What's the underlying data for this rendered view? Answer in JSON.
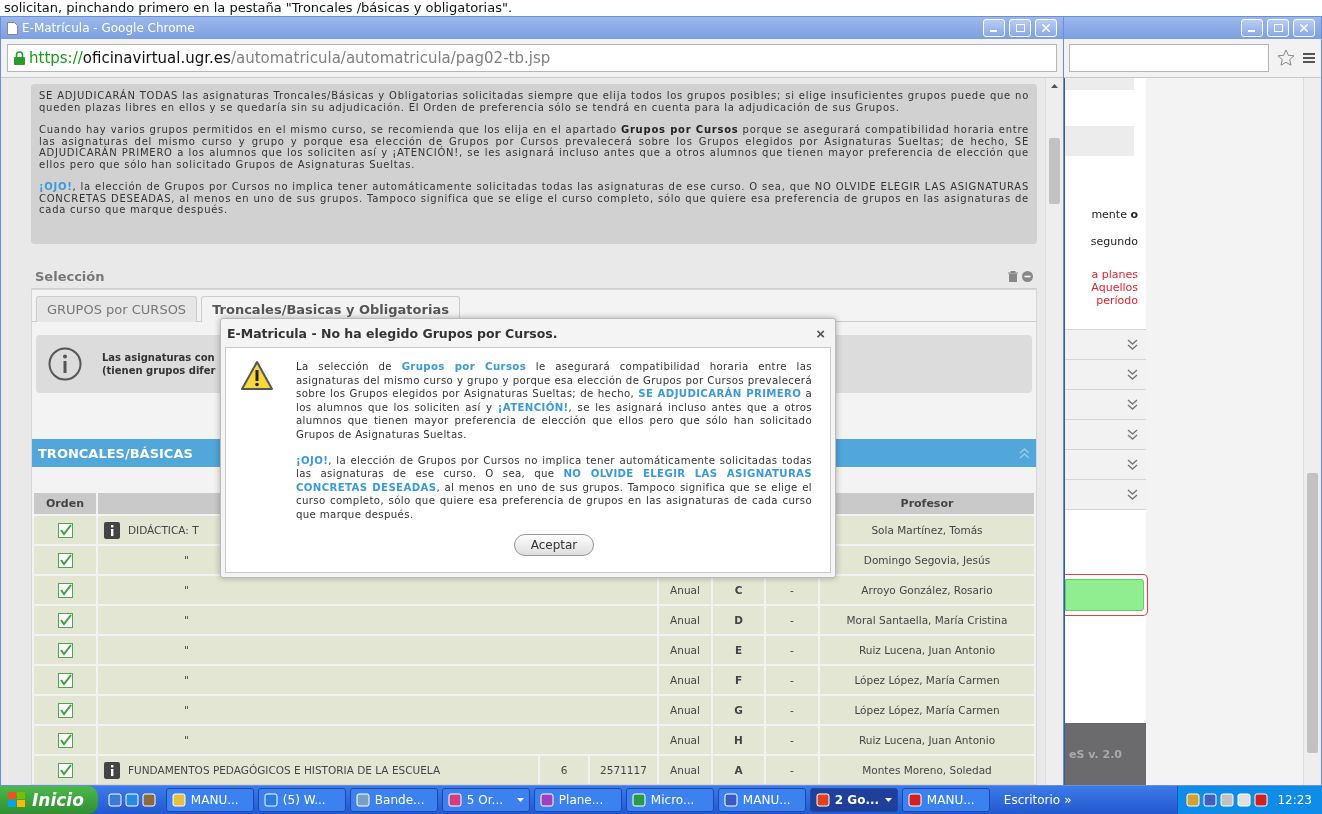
{
  "caption": "solicitan, pinchando primero en la pestaña \"Troncales /básicas y obligatorias\".",
  "window": {
    "title": "E-Matrícula - Google Chrome",
    "url": {
      "scheme": "https://",
      "host": "oficinavirtual.ugr.es",
      "path": "/automatricula/automatricula/pag02-tb.jsp"
    }
  },
  "info_box": [
    "SE ADJUDICARÁN TODAS las asignaturas Troncales/Básicas y Obligatorias solicitadas siempre que elija todos los grupos posibles; si elige insuficientes grupos puede que no queden plazas libres en ellos y se quedaría sin su adjudicación. El Orden de preferencia sólo se tendrá en cuenta para la adjudicación de sus Grupos.",
    "Cuando hay varios grupos permitidos en el mismo curso, se recomienda que los elija en el apartado **Grupos por Cursos** porque se asegurará compatibilidad horaria entre las asignaturas del mismo curso y grupo y porque esa elección de Grupos por Cursos prevalecerá sobre los Grupos elegidos por Asignaturas Sueltas; de hecho, SE ADJUDICARÁN PRIMERO a los alumnos que los soliciten así y ¡ATENCIÓN!, se les asignará incluso antes que a otros alumnos que tienen mayor preferencia de elección que ellos pero que sólo han solicitado Grupos de Asignaturas Sueltas.",
    "*¡OJO!*, la elección de Grupos por Cursos no implica tener automáticamente solicitadas todas las asignaturas de ese curso. O sea, que NO OLVIDE ELEGIR LAS ASIGNATURAS CONCRETAS DESEADAS, al menos en uno de sus grupos. Tampoco significa que se elige el curso completo, sólo que quiere esa preferencia de grupos en las asignaturas de cada curso que marque después."
  ],
  "panel": {
    "title": "Selección",
    "tabs": [
      {
        "label": "GRUPOS por CURSOS",
        "selected": false
      },
      {
        "label": "Troncales/Basicas y Obligatorias",
        "selected": true
      }
    ],
    "notice": [
      "Las asignaturas con",
      "(tienen grupos difer"
    ],
    "section": "TRONCALES/BÁSICAS",
    "header": {
      "orden": "Orden",
      "profesor": "Profesor"
    },
    "rows": [
      {
        "checked": true,
        "info_icon": true,
        "asignatura": "DIDÁCTICA: T",
        "profesor": "Sola Martínez, Tomás"
      },
      {
        "checked": true,
        "info_icon": false,
        "asignatura": "\"",
        "profesor": "Domingo Segovia, Jesús"
      },
      {
        "checked": true,
        "info_icon": false,
        "asignatura": "\"",
        "duracion": "Anual",
        "grupo": "C",
        "column_7": "-",
        "profesor": "Arroyo González, Rosario"
      },
      {
        "checked": true,
        "info_icon": false,
        "asignatura": "\"",
        "duracion": "Anual",
        "grupo": "D",
        "column_7": "-",
        "profesor": "Moral Santaella, María Cristina"
      },
      {
        "checked": true,
        "info_icon": false,
        "asignatura": "\"",
        "duracion": "Anual",
        "grupo": "E",
        "column_7": "-",
        "profesor": "Ruiz Lucena, Juan Antonio"
      },
      {
        "checked": true,
        "info_icon": false,
        "asignatura": "\"",
        "duracion": "Anual",
        "grupo": "F",
        "column_7": "-",
        "profesor": "López López, María Carmen"
      },
      {
        "checked": true,
        "info_icon": false,
        "asignatura": "\"",
        "duracion": "Anual",
        "grupo": "G",
        "column_7": "-",
        "profesor": "López López, María Carmen"
      },
      {
        "checked": true,
        "info_icon": false,
        "asignatura": "\"",
        "duracion": "Anual",
        "grupo": "H",
        "column_7": "-",
        "profesor": "Ruiz Lucena, Juan Antonio"
      },
      {
        "checked": true,
        "info_icon": true,
        "asignatura": "FUNDAMENTOS PEDAGÓGICOS E HISTORIA DE LA ESCUELA",
        "creditos": "6",
        "codigo": "2571117",
        "duracion": "Anual",
        "grupo": "A",
        "column_7": "-",
        "profesor": "Montes Moreno, Soledad"
      }
    ]
  },
  "dialog": {
    "title": "E-Matricula - No ha elegido Grupos por Cursos.",
    "close": "×",
    "paragraphs": [
      "La selección de **Grupos por Cursos** le asegurará compatibilidad horaria entre las asignaturas del mismo curso y grupo y porque esa elección de Grupos por Cursos prevalecerá sobre los Grupos elegidos por Asignaturas Sueltas; de hecho, **SE ADJUDICARÁN PRIMERO** a los alumnos que los soliciten así y **¡ATENCIÓN!**, se les asignará incluso antes que a otros alumnos que tienen mayor preferencia de elección que ellos pero que sólo han solicitado Grupos de Asignaturas Sueltas.",
      "**¡OJO!**, la elección de Grupos por Cursos no implica tener automáticamente solicitadas todas las asignaturas de ese curso. O sea, que **NO OLVIDE ELEGIR LAS ASIGNATURAS CONCRETAS DESEADAS**, al menos en uno de sus grupos. Tampoco significa que se elige el curso completo, sólo que quiere esa preferencia de grupos en las asignaturas de cada curso que marque después."
    ],
    "button": "Aceptar"
  },
  "back_window": {
    "notes": [
      {
        "text": "mente **o**",
        "color": "#222222"
      },
      {
        "text": "segundo",
        "color": "#222222"
      },
      {
        "text": "a planes",
        "color": "#e8202a"
      },
      {
        "text": "Aquellos",
        "color": "#e8202a"
      },
      {
        "text": "período",
        "color": "#e8202a"
      }
    ],
    "footer": "eS v. 2.0"
  },
  "taskbar": {
    "start": "Inicio",
    "tasks": [
      {
        "label": "MANU...",
        "selected": false,
        "grouped": false
      },
      {
        "label": "(5) W...",
        "selected": false,
        "grouped": false
      },
      {
        "label": "Bande...",
        "selected": false,
        "grouped": false
      },
      {
        "label": "5 Or...",
        "selected": false,
        "grouped": true
      },
      {
        "label": "Plane...",
        "selected": false,
        "grouped": false
      },
      {
        "label": "Micro...",
        "selected": false,
        "grouped": false
      },
      {
        "label": "MANU...",
        "selected": false,
        "grouped": false
      },
      {
        "label": "2 Go...",
        "selected": true,
        "grouped": true
      },
      {
        "label": "MANU...",
        "selected": false,
        "grouped": false
      }
    ],
    "toolbar": "Escritorio",
    "more": "»",
    "clock": "12:23"
  }
}
